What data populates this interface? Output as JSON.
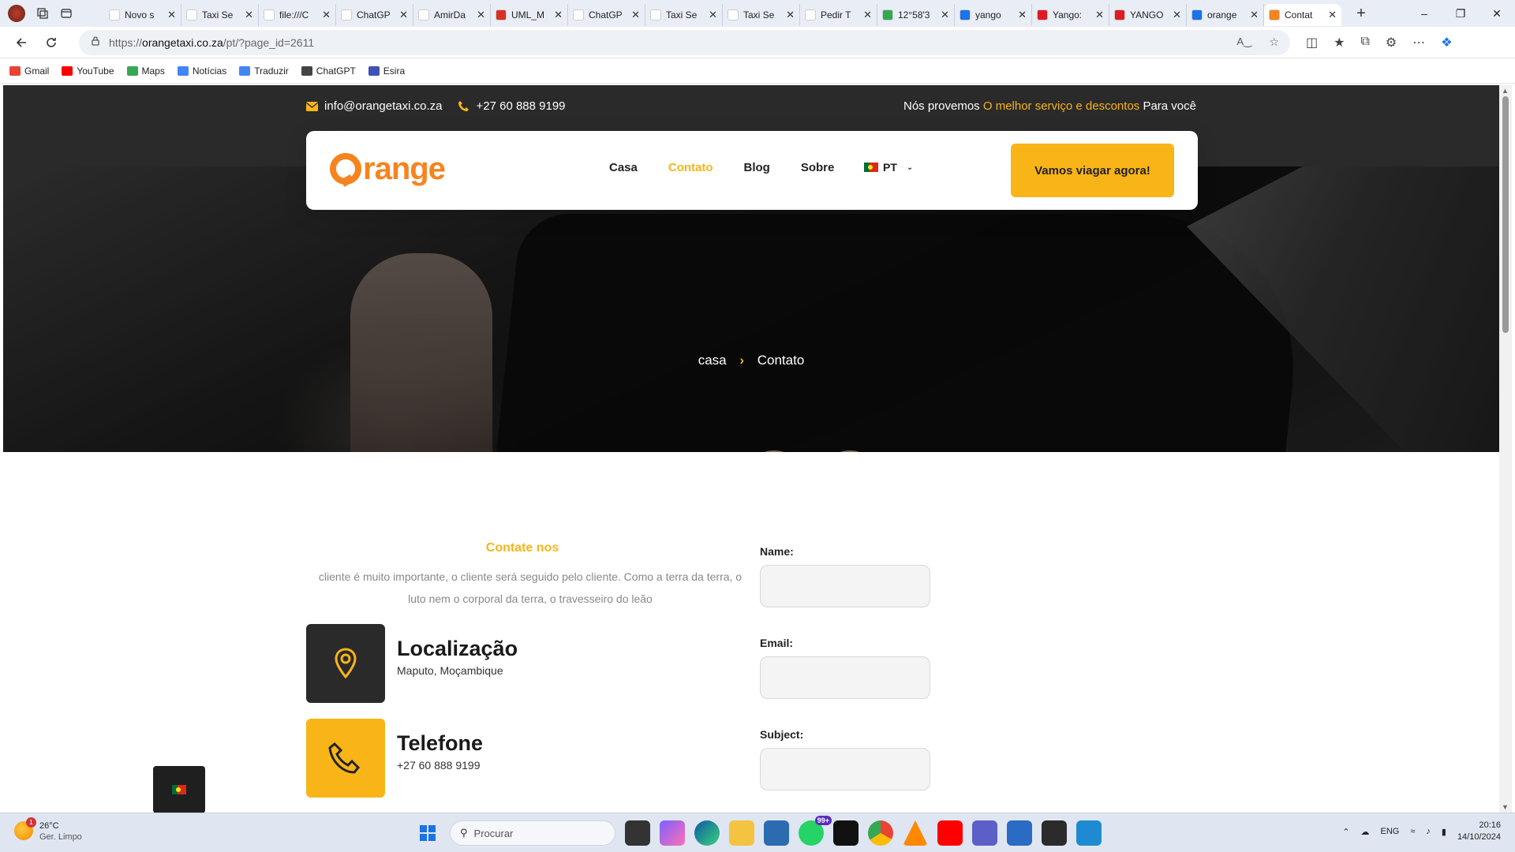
{
  "browser": {
    "tabs": [
      {
        "title": "Novo s",
        "color": "#ffffff"
      },
      {
        "title": "Taxi Se",
        "color": "#ffffff"
      },
      {
        "title": "file:///C",
        "color": "#ffffff"
      },
      {
        "title": "ChatGP",
        "color": "#ffffff"
      },
      {
        "title": "AmirDa",
        "color": "#ffffff"
      },
      {
        "title": "UML_M",
        "color": "#d93025"
      },
      {
        "title": "ChatGP",
        "color": "#ffffff"
      },
      {
        "title": "Taxi Se",
        "color": "#ffffff"
      },
      {
        "title": "Taxi Se",
        "color": "#ffffff"
      },
      {
        "title": "Pedir T",
        "color": "#ffffff"
      },
      {
        "title": "12°58'3",
        "color": "#34a853"
      },
      {
        "title": "yango",
        "color": "#1a73e8"
      },
      {
        "title": "Yango:",
        "color": "#e11b22"
      },
      {
        "title": "YANGO",
        "color": "#e11b22"
      },
      {
        "title": "orange",
        "color": "#1a73e8"
      },
      {
        "title": "Contat",
        "color": "#f7831e",
        "active": true
      }
    ],
    "url_prefix": "https://",
    "url_host": "orangetaxi.co.za",
    "url_path": "/pt/?page_id=2611",
    "bookmarks": [
      {
        "label": "Gmail",
        "color": "#ea4335"
      },
      {
        "label": "YouTube",
        "color": "#ff0000"
      },
      {
        "label": "Maps",
        "color": "#34a853"
      },
      {
        "label": "Notícias",
        "color": "#4285f4"
      },
      {
        "label": "Traduzir",
        "color": "#4285f4"
      },
      {
        "label": "ChatGPT",
        "color": "#444444"
      },
      {
        "label": "Esira",
        "color": "#3f51b5"
      }
    ]
  },
  "site": {
    "topbar": {
      "email": "info@orangetaxi.co.za",
      "phone": "+27 60 888 9199",
      "promo_pre": "Nós provemos",
      "promo_highlight": "O melhor serviço e descontos",
      "promo_post": "Para você"
    },
    "logo_text": "range",
    "menu": [
      {
        "label": "Casa"
      },
      {
        "label": "Contato",
        "active": true
      },
      {
        "label": "Blog"
      },
      {
        "label": "Sobre"
      }
    ],
    "lang": "PT",
    "cta": "Vamos viagar agora!",
    "breadcrumb": {
      "home": "casa",
      "current": "Contato"
    },
    "section_title": "Contate nos",
    "section_desc": "cliente é muito importante, o cliente será seguido pelo cliente. Como a terra da terra, o luto nem o corporal da terra, o travesseiro do leão",
    "info": [
      {
        "heading": "Localização",
        "sub": "Maputo, Moçambique"
      },
      {
        "heading": "Telefone",
        "sub": "+27 60 888 9199"
      }
    ],
    "form": {
      "name_label": "Name:",
      "email_label": "Email:",
      "subject_label": "Subject:"
    },
    "accent": "#f9b418",
    "brand": "#f7831e"
  },
  "taskbar": {
    "temp": "26°C",
    "weather": "Ger. Limpo",
    "weather_badge": "1",
    "search": "Procurar",
    "whatsapp_badge": "99+",
    "lang": "ENG",
    "time": "20:16",
    "date": "14/10/2024"
  }
}
